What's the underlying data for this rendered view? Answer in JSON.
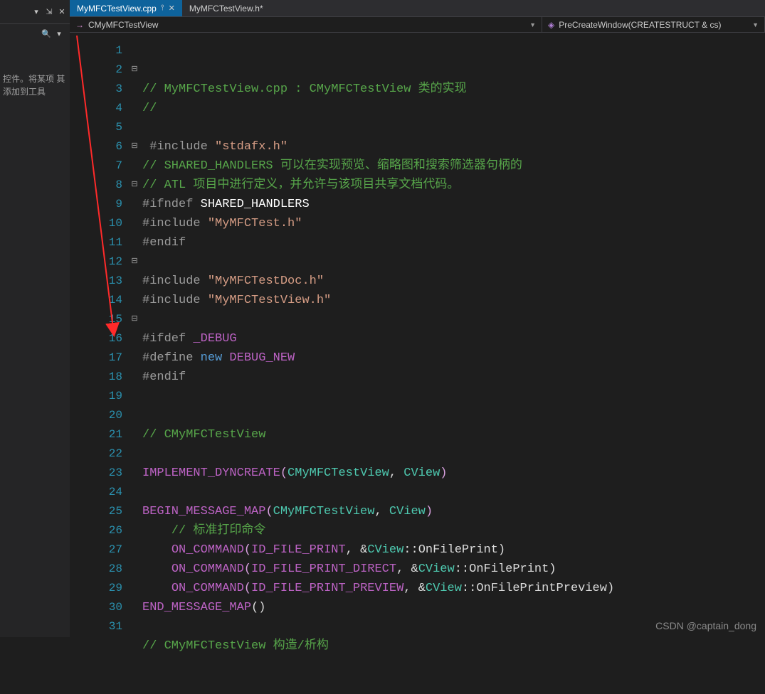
{
  "toolbox": {
    "hint": "控件。将某项\n其添加到工具"
  },
  "tabs": [
    {
      "label": "MyMFCTestView.cpp",
      "active": true,
      "pinned": true,
      "closeable": true
    },
    {
      "label": "MyMFCTestView.h*",
      "active": false,
      "pinned": false,
      "closeable": false
    }
  ],
  "nav": {
    "scope_prefix": "→",
    "scope": "CMyMFCTestView",
    "member_prefix": "",
    "member": "PreCreateWindow(CREATESTRUCT & cs)"
  },
  "lines": {
    "line_count": 31,
    "fold": {
      "2": "⊟",
      "6": "⊟",
      "8": "⊟",
      "12": "⊟",
      "15": "⊟"
    },
    "l2a": "// MyMFCTestView.cpp : ",
    "l2b": "CMyMFCTestView",
    "l2c": " 类的实现",
    "l3": "//",
    "l5a": "#include ",
    "l5b": "\"stdafx.h\"",
    "l6": "// SHARED_HANDLERS 可以在实现预览、缩略图和搜索筛选器句柄的",
    "l7": "// ATL 项目中进行定义，并允许与该项目共享文档代码。",
    "l8a": "#ifndef ",
    "l8b": "SHARED_HANDLERS",
    "l9a": "#include ",
    "l9b": "\"MyMFCTest.h\"",
    "l10": "#endif",
    "l12a": "#include ",
    "l12b": "\"MyMFCTestDoc.h\"",
    "l13a": "#include ",
    "l13b": "\"MyMFCTestView.h\"",
    "l15a": "#ifdef ",
    "l15b": "_DEBUG",
    "l16a": "#define ",
    "l16b": "new",
    "l16c": " DEBUG_NEW",
    "l17": "#endif",
    "l20": "// CMyMFCTestView",
    "l22a": "IMPLEMENT_DYNCREATE",
    "l22b": "(",
    "l22c": "CMyMFCTestView",
    "l22d": ", ",
    "l22e": "CView",
    "l22f": ")",
    "l24a": "BEGIN_MESSAGE_MAP",
    "l24b": "(",
    "l24c": "CMyMFCTestView",
    "l24d": ", ",
    "l24e": "CView",
    "l24f": ")",
    "l25": "    // 标准打印命令",
    "l26a": "    ",
    "l26b": "ON_COMMAND",
    "l26c": "(",
    "l26d": "ID_FILE_PRINT",
    "l26e": ", &",
    "l26f": "CView",
    "l26g": "::OnFilePrint)",
    "l27a": "    ",
    "l27b": "ON_COMMAND",
    "l27c": "(",
    "l27d": "ID_FILE_PRINT_DIRECT",
    "l27e": ", &",
    "l27f": "CView",
    "l27g": "::OnFilePrint)",
    "l28a": "    ",
    "l28b": "ON_COMMAND",
    "l28c": "(",
    "l28d": "ID_FILE_PRINT_PREVIEW",
    "l28e": ", &",
    "l28f": "CView",
    "l28g": "::OnFilePrintPreview)",
    "l29a": "END_MESSAGE_MAP",
    "l29b": "()",
    "l31": "// CMyMFCTestView 构造/析构"
  },
  "watermark": "CSDN @captain_dong"
}
